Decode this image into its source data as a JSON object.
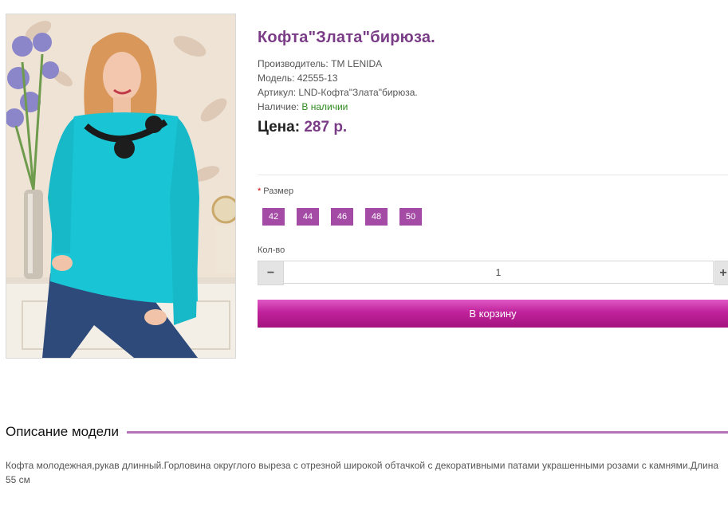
{
  "product": {
    "title": "Кофта\"Злата\"бирюза.",
    "manufacturer_label": "Производитель:",
    "manufacturer": "TM LENIDA",
    "model_label": "Модель:",
    "model": "42555-13",
    "sku_label": "Артикул:",
    "sku": "LND-Кофта\"Злата\"бирюза.",
    "availability_label": "Наличие:",
    "availability": "В наличии",
    "price_label": "Цена:",
    "price": "287 р."
  },
  "options": {
    "size_required_mark": "*",
    "size_label": "Размер",
    "sizes": [
      "42",
      "44",
      "46",
      "48",
      "50"
    ],
    "quantity_label": "Кол-во",
    "quantity_value": "1",
    "minus_symbol": "−",
    "plus_symbol": "+"
  },
  "cart_button": "В корзину",
  "description": {
    "title": "Описание модели",
    "text": "Кофта молодежная,рукав длинный.Горловина округлого выреза с отрезной широкой обтачкой с декоративными патами украшенными розами с камнями.Длина 55 см"
  },
  "colors": {
    "accent_purple": "#7a3c86",
    "size_button": "#a44ba5",
    "cart_gradient_top": "#de58c4",
    "cart_gradient_bottom": "#a4137f",
    "in_stock_green": "#2e8b1e",
    "blouse_turquoise": "#19c5d4"
  }
}
